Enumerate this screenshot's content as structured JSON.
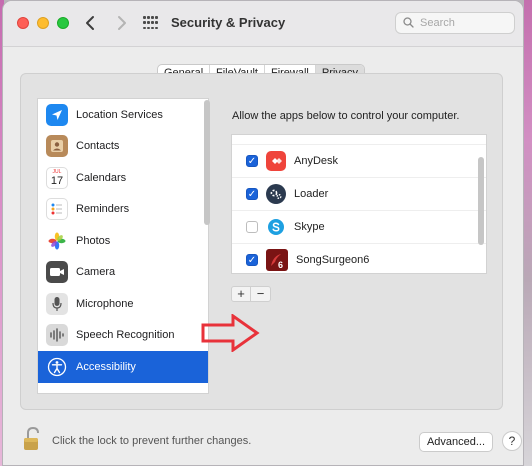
{
  "window": {
    "title": "Security & Privacy",
    "search_placeholder": "Search"
  },
  "icons": {
    "back": "chevron-left-icon",
    "forward": "chevron-right-icon",
    "grid": "grid-icon",
    "search": "search-icon",
    "lock": "lock-icon",
    "help": "help-icon",
    "annotation": "arrow-icon"
  },
  "tabs": [
    {
      "label": "General",
      "active": false
    },
    {
      "label": "FileVault",
      "active": false
    },
    {
      "label": "Firewall",
      "active": false
    },
    {
      "label": "Privacy",
      "active": true
    }
  ],
  "sidebar": {
    "items": [
      {
        "label": "Location Services",
        "icon": "location-icon"
      },
      {
        "label": "Contacts",
        "icon": "contacts-icon"
      },
      {
        "label": "Calendars",
        "icon": "calendar-icon",
        "icon_text_month": "JUL",
        "icon_text_day": "17"
      },
      {
        "label": "Reminders",
        "icon": "reminders-icon"
      },
      {
        "label": "Photos",
        "icon": "photos-icon"
      },
      {
        "label": "Camera",
        "icon": "camera-icon"
      },
      {
        "label": "Microphone",
        "icon": "microphone-icon"
      },
      {
        "label": "Speech Recognition",
        "icon": "speech-recognition-icon"
      },
      {
        "label": "Accessibility",
        "icon": "accessibility-icon",
        "selected": true
      }
    ]
  },
  "main": {
    "description": "Allow the apps below to control your computer.",
    "apps": [
      {
        "name": "AnyDesk",
        "checked": true,
        "icon": "anydesk-icon"
      },
      {
        "name": "Loader",
        "checked": true,
        "icon": "loader-icon"
      },
      {
        "name": "Skype",
        "checked": false,
        "icon": "skype-icon"
      },
      {
        "name": "SongSurgeon6",
        "checked": true,
        "icon": "songsurgeon-icon"
      }
    ],
    "add_label": "+",
    "remove_label": "−"
  },
  "footer": {
    "lock_text": "Click the lock to prevent further changes.",
    "advanced_label": "Advanced...",
    "help_label": "?"
  },
  "colors": {
    "accent": "#1a63d9",
    "annotation_red": "#e8323a"
  }
}
